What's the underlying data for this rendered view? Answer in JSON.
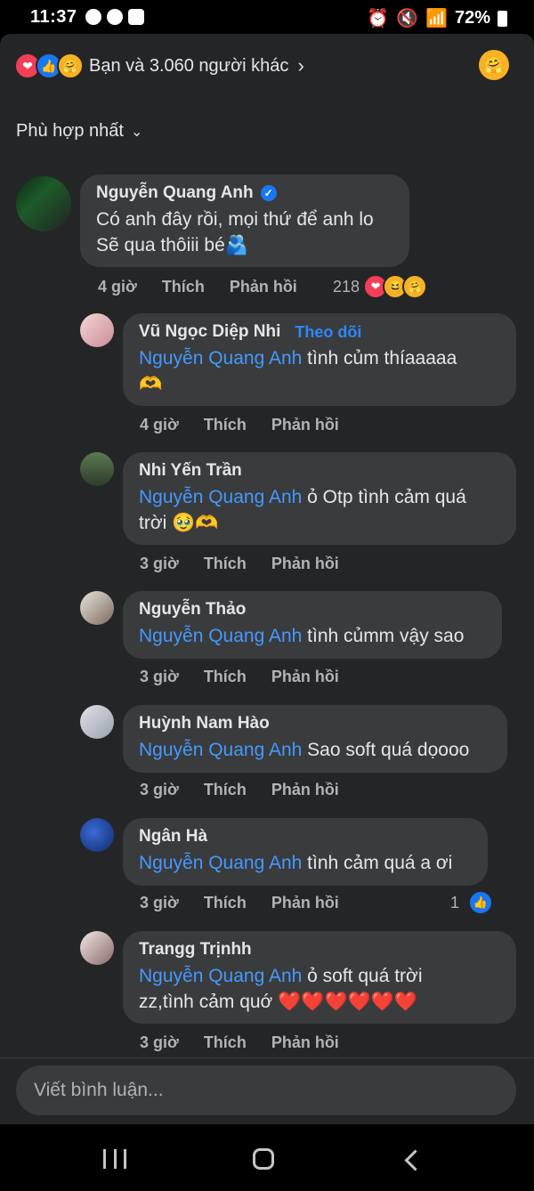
{
  "status_bar": {
    "time": "11:37",
    "battery": "72%"
  },
  "reactions_bar": {
    "summary": "Bạn và 3.060 người khác"
  },
  "sort": {
    "label": "Phù hợp nhất"
  },
  "comments": [
    {
      "name": "Nguyễn Quang Anh",
      "verified": true,
      "line1": "Có anh đây rồi, mọi thứ để anh lo",
      "line2": "Sẽ qua thôiii bé🫂",
      "time": "4 giờ",
      "like": "Thích",
      "reply": "Phản hồi",
      "reaction_count": "218"
    },
    {
      "name": "Vũ Ngọc Diệp Nhi",
      "follow": "Theo dõi",
      "mention": "Nguyễn Quang Anh",
      "text": " tình củm thíaaaaa",
      "line2": "🫶",
      "time": "4 giờ",
      "like": "Thích",
      "reply": "Phản hồi"
    },
    {
      "name": "Nhi Yến Trần",
      "mention": "Nguyễn Quang Anh",
      "text": " ỏ Otp tình cảm quá",
      "line2": "trời 🥹🫶",
      "time": "3 giờ",
      "like": "Thích",
      "reply": "Phản hồi"
    },
    {
      "name": "Nguyễn Thảo",
      "mention": "Nguyễn Quang Anh",
      "text": " tình củmm vậy sao",
      "time": "3 giờ",
      "like": "Thích",
      "reply": "Phản hồi"
    },
    {
      "name": "Huỳnh Nam Hào",
      "mention": "Nguyễn Quang Anh",
      "text": " Sao soft quá dọooo",
      "time": "3 giờ",
      "like": "Thích",
      "reply": "Phản hồi"
    },
    {
      "name": "Ngân Hà",
      "mention": "Nguyễn Quang Anh",
      "text": " tình cảm quá a ơi",
      "time": "3 giờ",
      "like": "Thích",
      "reply": "Phản hồi",
      "reaction_count": "1"
    },
    {
      "name": "Trangg Trịnhh",
      "mention": "Nguyễn Quang Anh",
      "text": " ỏ soft quá trời",
      "line2": "zz,tình cảm quớ ❤️❤️❤️❤️❤️❤️",
      "time": "3 giờ",
      "like": "Thích",
      "reply": "Phản hồi"
    }
  ],
  "input": {
    "placeholder": "Viết bình luận..."
  },
  "colors": {
    "background": "#242526",
    "bubble": "#3a3b3c",
    "mention": "#4599ff",
    "follow": "#2d88ff"
  }
}
